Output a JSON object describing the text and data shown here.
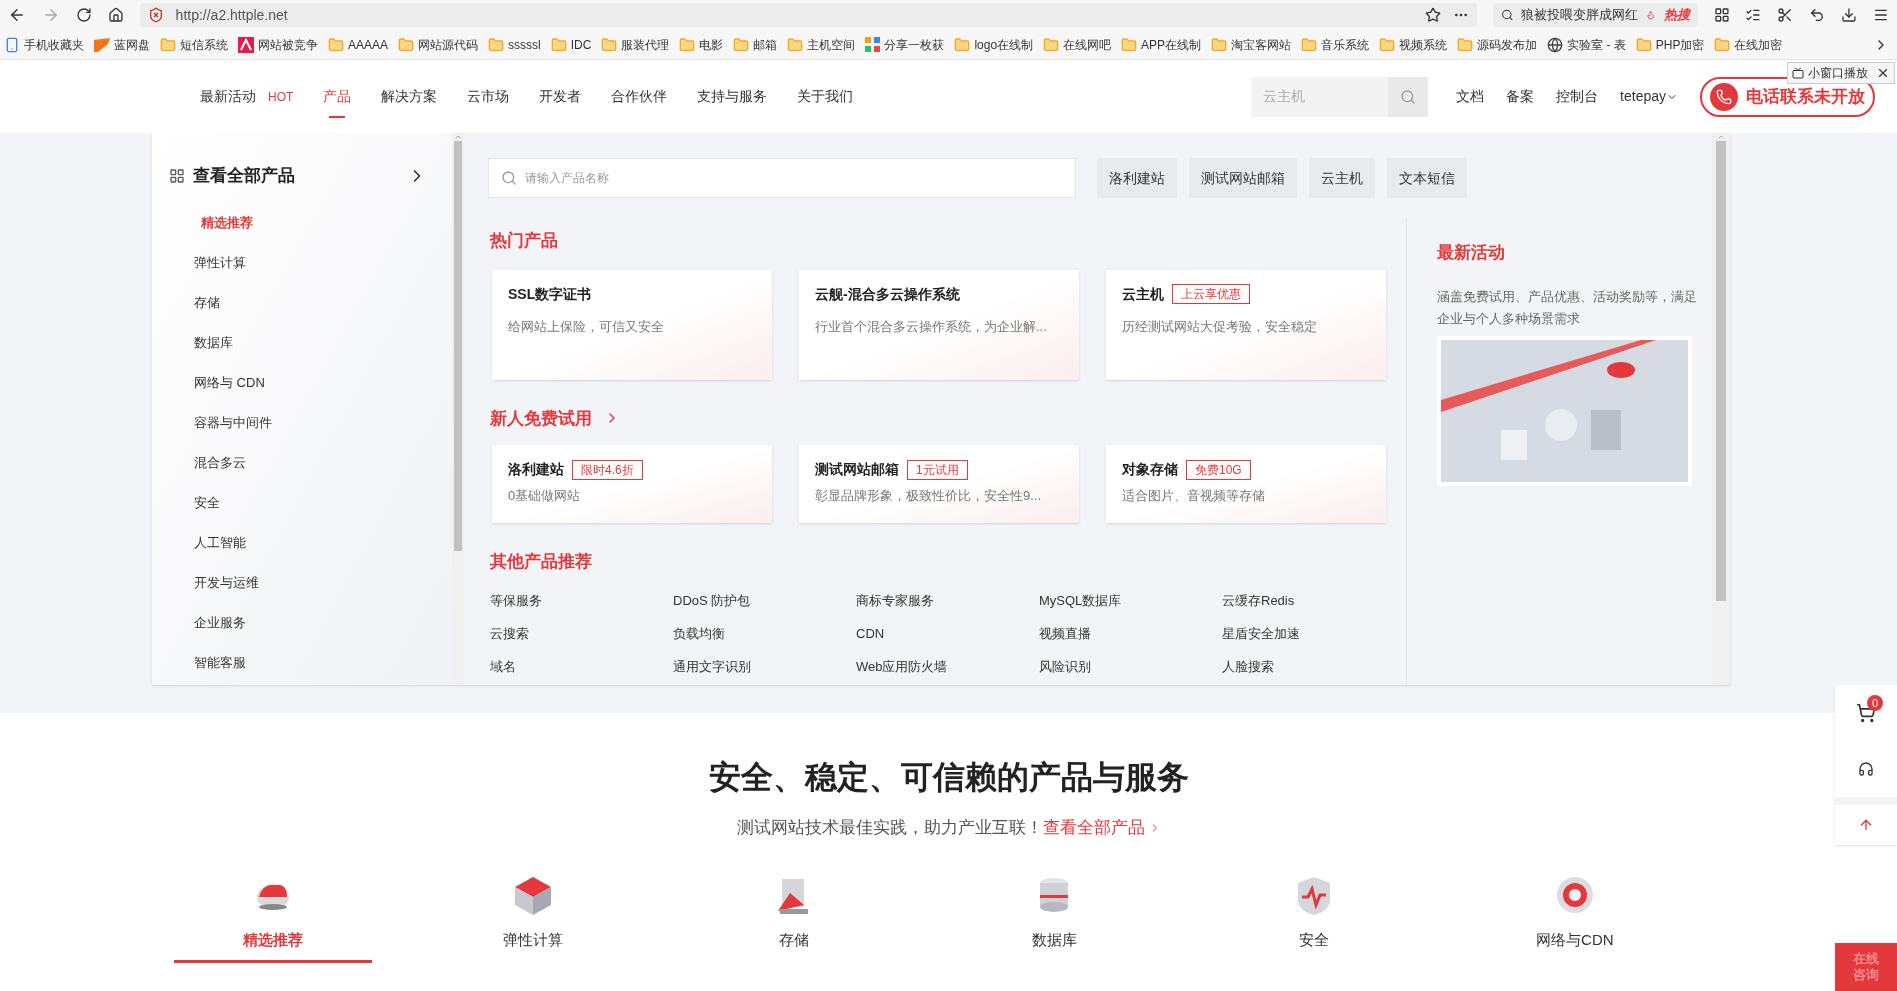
{
  "browser": {
    "url": "http://a2.httple.net",
    "search_hint": "狼被投喂变胖成网红",
    "hot_badge": "热搜",
    "bookmarks": [
      {
        "label": "手机收藏夹",
        "kind": "phone"
      },
      {
        "label": "蓝网盘",
        "kind": "flag"
      },
      {
        "label": "短信系统",
        "kind": "folder"
      },
      {
        "label": "网站被竞争",
        "kind": "logo"
      },
      {
        "label": "AAAAA",
        "kind": "folder"
      },
      {
        "label": "网站源代码",
        "kind": "folder"
      },
      {
        "label": "sssssl",
        "kind": "folder"
      },
      {
        "label": "IDC",
        "kind": "folder"
      },
      {
        "label": "服装代理",
        "kind": "folder"
      },
      {
        "label": "电影",
        "kind": "folder"
      },
      {
        "label": "邮箱",
        "kind": "folder"
      },
      {
        "label": "主机空间",
        "kind": "folder"
      },
      {
        "label": "分享一枚获",
        "kind": "grid"
      },
      {
        "label": "logo在线制",
        "kind": "folder"
      },
      {
        "label": "在线网吧",
        "kind": "folder"
      },
      {
        "label": "APP在线制",
        "kind": "folder"
      },
      {
        "label": "淘宝客网站",
        "kind": "folder"
      },
      {
        "label": "音乐系统",
        "kind": "folder"
      },
      {
        "label": "视频系统",
        "kind": "folder"
      },
      {
        "label": "源码发布加",
        "kind": "folder"
      },
      {
        "label": "实验室 - 表",
        "kind": "globe"
      },
      {
        "label": "PHP加密",
        "kind": "folder"
      },
      {
        "label": "在线加密",
        "kind": "folder"
      }
    ]
  },
  "header": {
    "nav": [
      {
        "label": "最新活动",
        "badge": "HOT",
        "selected": false
      },
      {
        "label": "产品",
        "selected": true
      },
      {
        "label": "解决方案",
        "selected": false
      },
      {
        "label": "云市场",
        "selected": false
      },
      {
        "label": "开发者",
        "selected": false
      },
      {
        "label": "合作伙伴",
        "selected": false
      },
      {
        "label": "支持与服务",
        "selected": false
      },
      {
        "label": "关于我们",
        "selected": false
      }
    ],
    "search": {
      "placeholder": "云主机"
    },
    "links": [
      "文档",
      "备案",
      "控制台"
    ],
    "user": "tetepay",
    "phone_button": "电话联系未开放",
    "popup": "小窗口播放"
  },
  "mega_menu": {
    "sidebar": {
      "title": "查看全部产品",
      "items": [
        {
          "label": "精选推荐",
          "selected": true
        },
        {
          "label": "弹性计算",
          "selected": false
        },
        {
          "label": "存储",
          "selected": false
        },
        {
          "label": "数据库",
          "selected": false
        },
        {
          "label": "网络与 CDN",
          "selected": false
        },
        {
          "label": "容器与中间件",
          "selected": false
        },
        {
          "label": "混合多云",
          "selected": false
        },
        {
          "label": "安全",
          "selected": false
        },
        {
          "label": "人工智能",
          "selected": false
        },
        {
          "label": "开发与运维",
          "selected": false
        },
        {
          "label": "企业服务",
          "selected": false
        },
        {
          "label": "智能客服",
          "selected": false
        }
      ]
    },
    "search": {
      "placeholder": "请输入产品名称"
    },
    "quick_tags": [
      "洛利建站",
      "测试网站邮箱",
      "云主机",
      "文本短信"
    ],
    "hot": {
      "title": "热门产品",
      "cards": [
        {
          "name": "SSL数字证书",
          "desc": "给网站上保险，可信又安全"
        },
        {
          "name": "云舰-混合多云操作系统",
          "desc": "行业首个混合多云操作系统，为企业解..."
        },
        {
          "name": "云主机",
          "tag": "上云享优惠",
          "desc": "历经测试网站大促考验，安全稳定"
        }
      ]
    },
    "trial": {
      "title": "新人免费试用",
      "cards": [
        {
          "name": "洛利建站",
          "tag": "限时4.6折",
          "desc": "0基础做网站"
        },
        {
          "name": "测试网站邮箱",
          "tag": "1元试用",
          "desc": "彰显品牌形象，极致性价比，安全性9..."
        },
        {
          "name": "对象存储",
          "tag": "免费10G",
          "desc": "适合图片、音视频等存储"
        }
      ]
    },
    "other": {
      "title": "其他产品推荐",
      "items": [
        "等保服务",
        "DDoS 防护包",
        "商标专家服务",
        "MySQL数据库",
        "云缓存Redis",
        "云搜索",
        "负载均衡",
        "CDN",
        "视频直播",
        "星盾安全加速",
        "域名",
        "通用文字识别",
        "Web应用防火墙",
        "风险识别",
        "人脸搜索"
      ]
    },
    "activity": {
      "title": "最新活动",
      "desc": "涵盖免费试用、产品优惠、活动奖励等，满足企业与个人多种场景需求"
    }
  },
  "section": {
    "title": "安全、稳定、可信赖的产品与服务",
    "subtitle": "测试网站技术最佳实践，助力产业互联！",
    "link": "查看全部产品",
    "tabs": [
      {
        "label": "精选推荐",
        "selected": true
      },
      {
        "label": "弹性计算",
        "selected": false
      },
      {
        "label": "存储",
        "selected": false
      },
      {
        "label": "数据库",
        "selected": false
      },
      {
        "label": "安全",
        "selected": false
      },
      {
        "label": "网络与CDN",
        "selected": false
      }
    ]
  },
  "float_bar": {
    "cart_count": "0",
    "consult": "在线咨询"
  }
}
